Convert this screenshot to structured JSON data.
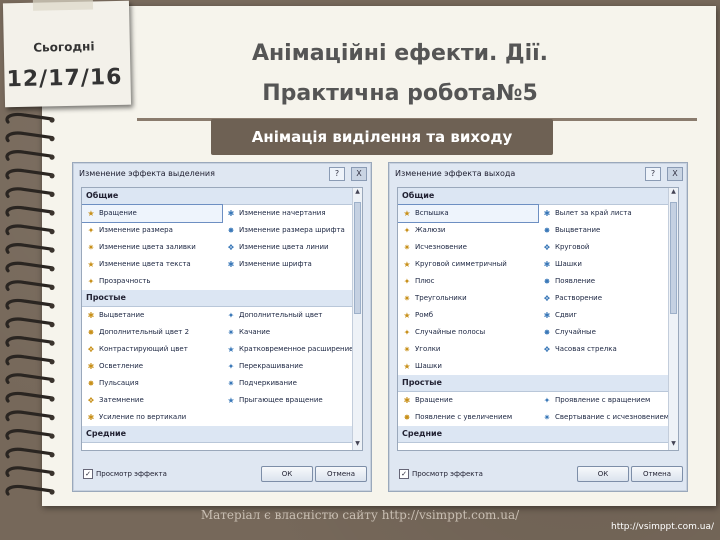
{
  "note": {
    "label": "Сьогодні",
    "date": "12/17/16"
  },
  "title": {
    "line1": "Анімаційні ефекти. Дії.",
    "line2": "Практична робота№5"
  },
  "subtitle": "Анімація виділення та виходу",
  "dialog_left": {
    "title": "Изменение эффекта выделения",
    "help": "?",
    "close": "X",
    "sections": [
      {
        "name": "Общие",
        "items": [
          "Вращение",
          "Изменение начертания",
          "Изменение размера",
          "Изменение размера шрифта",
          "Изменение цвета заливки",
          "Изменение цвета линии",
          "Изменение цвета текста",
          "Изменение шрифта",
          "Прозрачность",
          ""
        ]
      },
      {
        "name": "Простые",
        "items": [
          "Выцветание",
          "Дополнительный цвет",
          "Дополнительный цвет 2",
          "Качание",
          "Контрастирующий цвет",
          "Кратковременное расширение",
          "Осветление",
          "Перекрашивание",
          "Пульсация",
          "Подчеркивание",
          "Затемнение",
          "Прыгающее вращение",
          "Усиление по вертикали",
          ""
        ]
      },
      {
        "name": "Средние",
        "items": []
      }
    ],
    "checkbox_label": "Просмотр эффекта",
    "ok": "ОК",
    "cancel": "Отмена"
  },
  "dialog_right": {
    "title": "Изменение эффекта выхода",
    "help": "?",
    "close": "X",
    "sections": [
      {
        "name": "Общие",
        "items": [
          "Вспышка",
          "Вылет за край листа",
          "Жалюзи",
          "Выцветание",
          "Исчезновение",
          "Круговой",
          "Круговой симметричный",
          "Шашки",
          "Плюс",
          "Появление",
          "Треугольники",
          "Растворение",
          "Ромб",
          "Сдвиг",
          "Случайные полосы",
          "Случайные",
          "Уголки",
          "Часовая стрелка",
          "Шашки",
          ""
        ]
      },
      {
        "name": "Простые",
        "items": [
          "Вращение",
          "Проявление с вращением",
          "Появление с увеличением",
          "Свертывание с исчезновением"
        ]
      },
      {
        "name": "Средние",
        "items": []
      }
    ],
    "checkbox_label": "Просмотр эффекта",
    "ok": "ОК",
    "cancel": "Отмена"
  },
  "watermark": "Матеріал є власністю сайту http://vsimppt.com.ua/",
  "url": "http://vsimppt.com.ua/"
}
